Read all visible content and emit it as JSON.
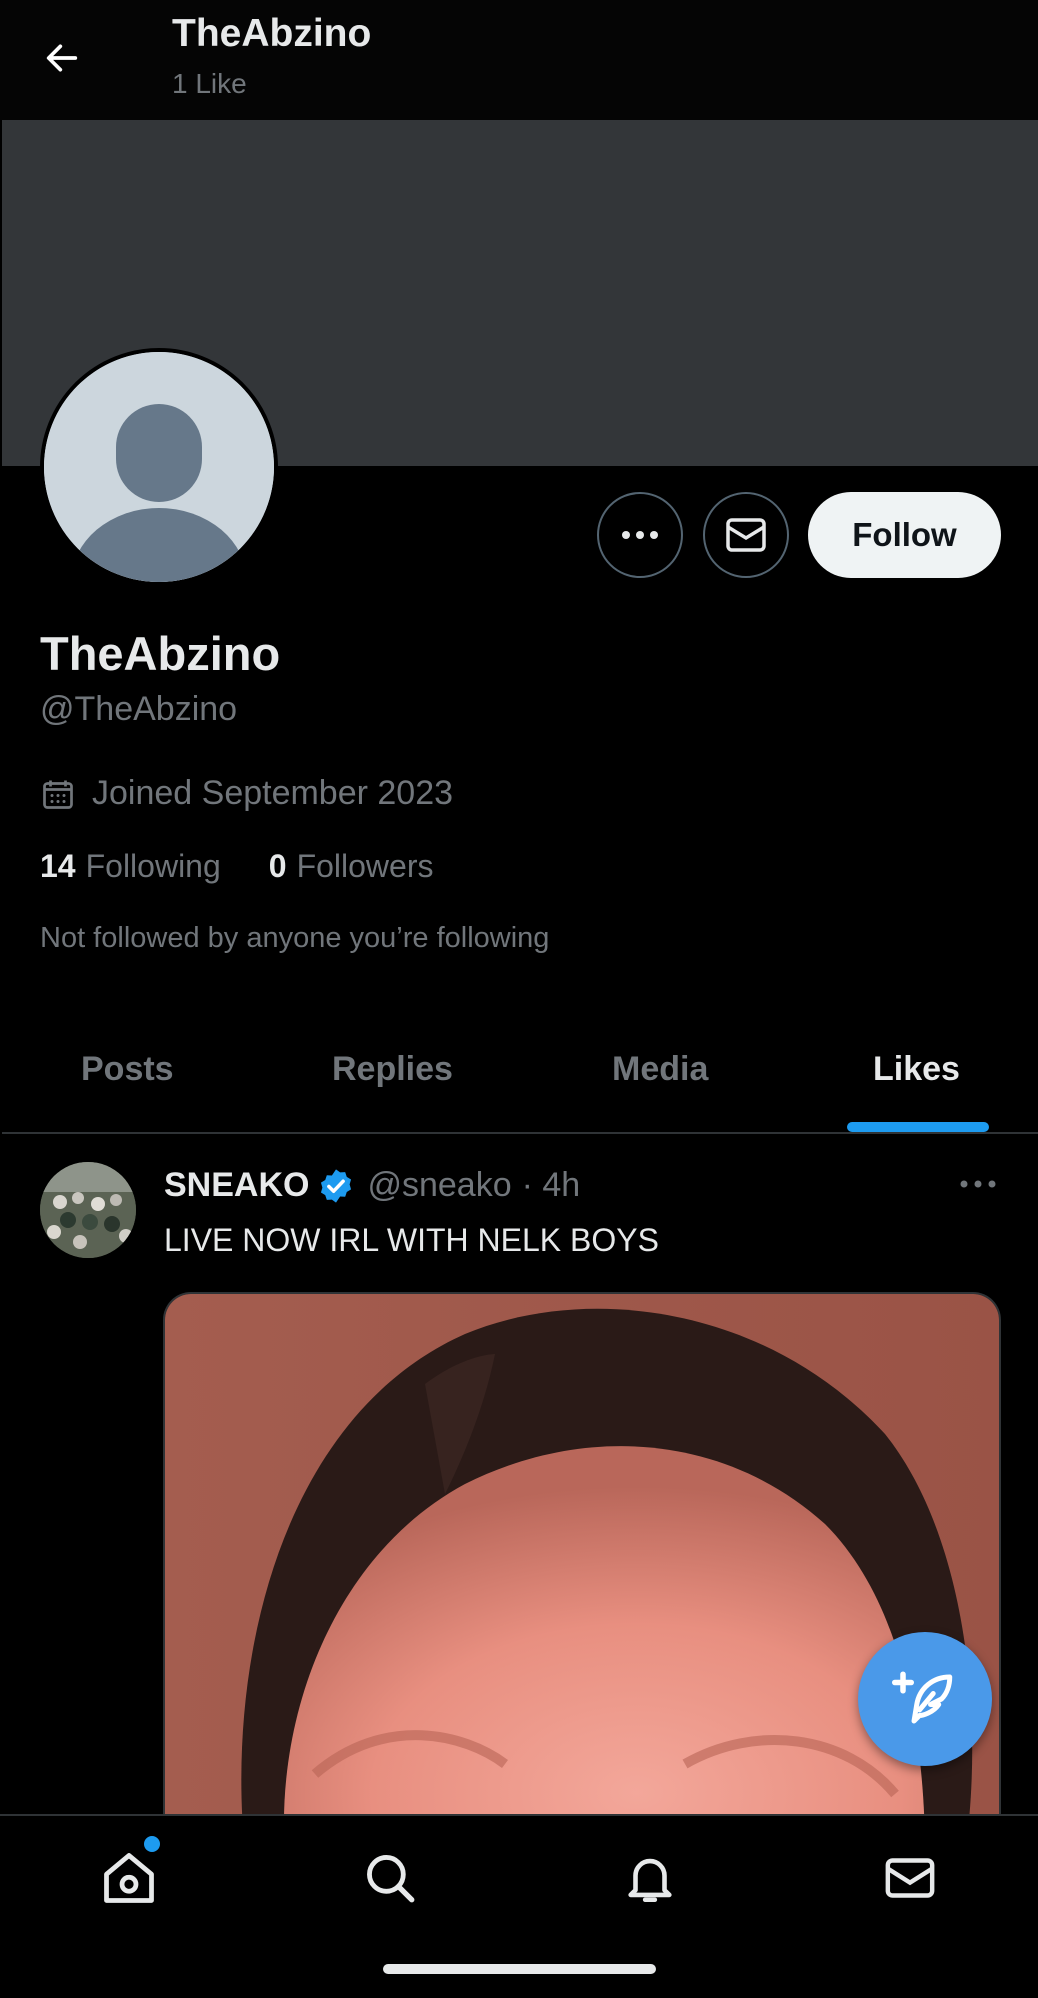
{
  "header": {
    "title": "TheAbzino",
    "subtitle": "1 Like"
  },
  "profile": {
    "name": "TheAbzino",
    "handle": "@TheAbzino",
    "joined": "Joined September 2023",
    "following_count": "14",
    "following_label": "Following",
    "followers_count": "0",
    "followers_label": "Followers",
    "not_followed_text": "Not followed by anyone you’re following",
    "follow_label": "Follow"
  },
  "tabs": [
    {
      "label": "Posts"
    },
    {
      "label": "Replies"
    },
    {
      "label": "Media"
    },
    {
      "label": "Likes"
    }
  ],
  "post": {
    "author_name": "SNEAKO",
    "author_handle": "@sneako",
    "time": "· 4h",
    "text": "LIVE NOW IRL WITH NELK BOYS"
  },
  "colors": {
    "accent": "#1d9bf0",
    "fab": "#4a99e9",
    "banner": "#333639",
    "muted_text": "#71767b"
  },
  "icons": {
    "back": "arrow-left-icon",
    "more": "ellipsis-icon",
    "message": "envelope-icon",
    "calendar": "calendar-icon",
    "verified": "verified-badge-icon",
    "compose": "compose-feather-icon",
    "nav": [
      "home-icon",
      "search-icon",
      "bell-icon",
      "mail-icon"
    ]
  }
}
